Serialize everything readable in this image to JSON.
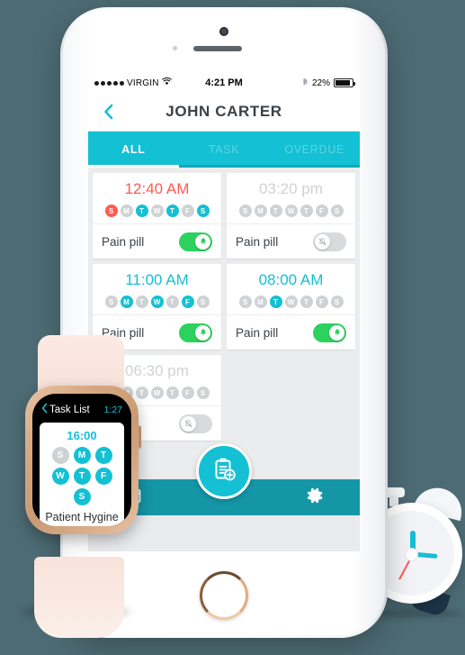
{
  "background_color": "#4d6b74",
  "accent_color": "#14c0d4",
  "alert_color": "#ff5a52",
  "toggle_on_color": "#2dd15e",
  "phone": {
    "statusbar": {
      "carrier": "VIRGIN",
      "wifi_icon": "wifi-icon",
      "time": "4:21 PM",
      "bluetooth_icon": "bluetooth-icon",
      "battery_percent": "22%",
      "battery_icon": "battery-icon"
    },
    "navbar": {
      "back_icon": "chevron-left-icon",
      "title": "JOHN CARTER"
    },
    "tabs": [
      {
        "label": "ALL",
        "active": true
      },
      {
        "label": "TASK",
        "active": false
      },
      {
        "label": "OVERDUE",
        "active": false
      }
    ],
    "cards": [
      {
        "time": "12:40 AM",
        "time_state": "overdue",
        "days": [
          {
            "letter": "S",
            "state": "alert"
          },
          {
            "letter": "M",
            "state": "off"
          },
          {
            "letter": "T",
            "state": "on"
          },
          {
            "letter": "W",
            "state": "off"
          },
          {
            "letter": "T",
            "state": "on"
          },
          {
            "letter": "F",
            "state": "off"
          },
          {
            "letter": "S",
            "state": "on"
          }
        ],
        "task_label": "Pain pill",
        "toggle": "on",
        "toggle_icon": "bell-icon"
      },
      {
        "time": "03:20 pm",
        "time_state": "disabled",
        "days": [
          {
            "letter": "S",
            "state": "off"
          },
          {
            "letter": "M",
            "state": "off"
          },
          {
            "letter": "T",
            "state": "off"
          },
          {
            "letter": "W",
            "state": "off"
          },
          {
            "letter": "T",
            "state": "off"
          },
          {
            "letter": "F",
            "state": "off"
          },
          {
            "letter": "S",
            "state": "off"
          }
        ],
        "task_label": "Pain pill",
        "toggle": "off",
        "toggle_icon": "bell-slash-icon"
      },
      {
        "time": "11:00 AM",
        "time_state": "active",
        "days": [
          {
            "letter": "S",
            "state": "off"
          },
          {
            "letter": "M",
            "state": "on"
          },
          {
            "letter": "T",
            "state": "off"
          },
          {
            "letter": "W",
            "state": "on"
          },
          {
            "letter": "T",
            "state": "off"
          },
          {
            "letter": "F",
            "state": "on"
          },
          {
            "letter": "S",
            "state": "off"
          }
        ],
        "task_label": "Pain pill",
        "toggle": "on",
        "toggle_icon": "bell-icon"
      },
      {
        "time": "08:00 AM",
        "time_state": "active",
        "days": [
          {
            "letter": "S",
            "state": "off"
          },
          {
            "letter": "M",
            "state": "off"
          },
          {
            "letter": "T",
            "state": "on"
          },
          {
            "letter": "W",
            "state": "off"
          },
          {
            "letter": "T",
            "state": "off"
          },
          {
            "letter": "F",
            "state": "off"
          },
          {
            "letter": "S",
            "state": "off"
          }
        ],
        "task_label": "Pain pill",
        "toggle": "on",
        "toggle_icon": "bell-icon"
      },
      {
        "time": "06:30 pm",
        "time_state": "disabled",
        "days": [
          {
            "letter": "S",
            "state": "off"
          },
          {
            "letter": "M",
            "state": "off"
          },
          {
            "letter": "T",
            "state": "off"
          },
          {
            "letter": "W",
            "state": "off"
          },
          {
            "letter": "T",
            "state": "off"
          },
          {
            "letter": "F",
            "state": "off"
          },
          {
            "letter": "S",
            "state": "off"
          }
        ],
        "task_label": "",
        "toggle": "off",
        "toggle_icon": "bell-slash-icon"
      }
    ],
    "bottombar": {
      "calendar_icon": "calendar-icon",
      "add_task_icon": "clipboard-add-icon",
      "settings_icon": "gear-icon"
    }
  },
  "watch": {
    "back_icon": "chevron-left-icon",
    "back_label": "Task List",
    "time": "1:27",
    "card": {
      "time": "16:00",
      "days": [
        {
          "letter": "S",
          "state": "off"
        },
        {
          "letter": "M",
          "state": "on"
        },
        {
          "letter": "T",
          "state": "on"
        },
        {
          "letter": "W",
          "state": "on"
        },
        {
          "letter": "T",
          "state": "on"
        },
        {
          "letter": "F",
          "state": "on"
        },
        {
          "letter": "S",
          "state": "on"
        }
      ],
      "label": "Patient Hygine"
    }
  }
}
